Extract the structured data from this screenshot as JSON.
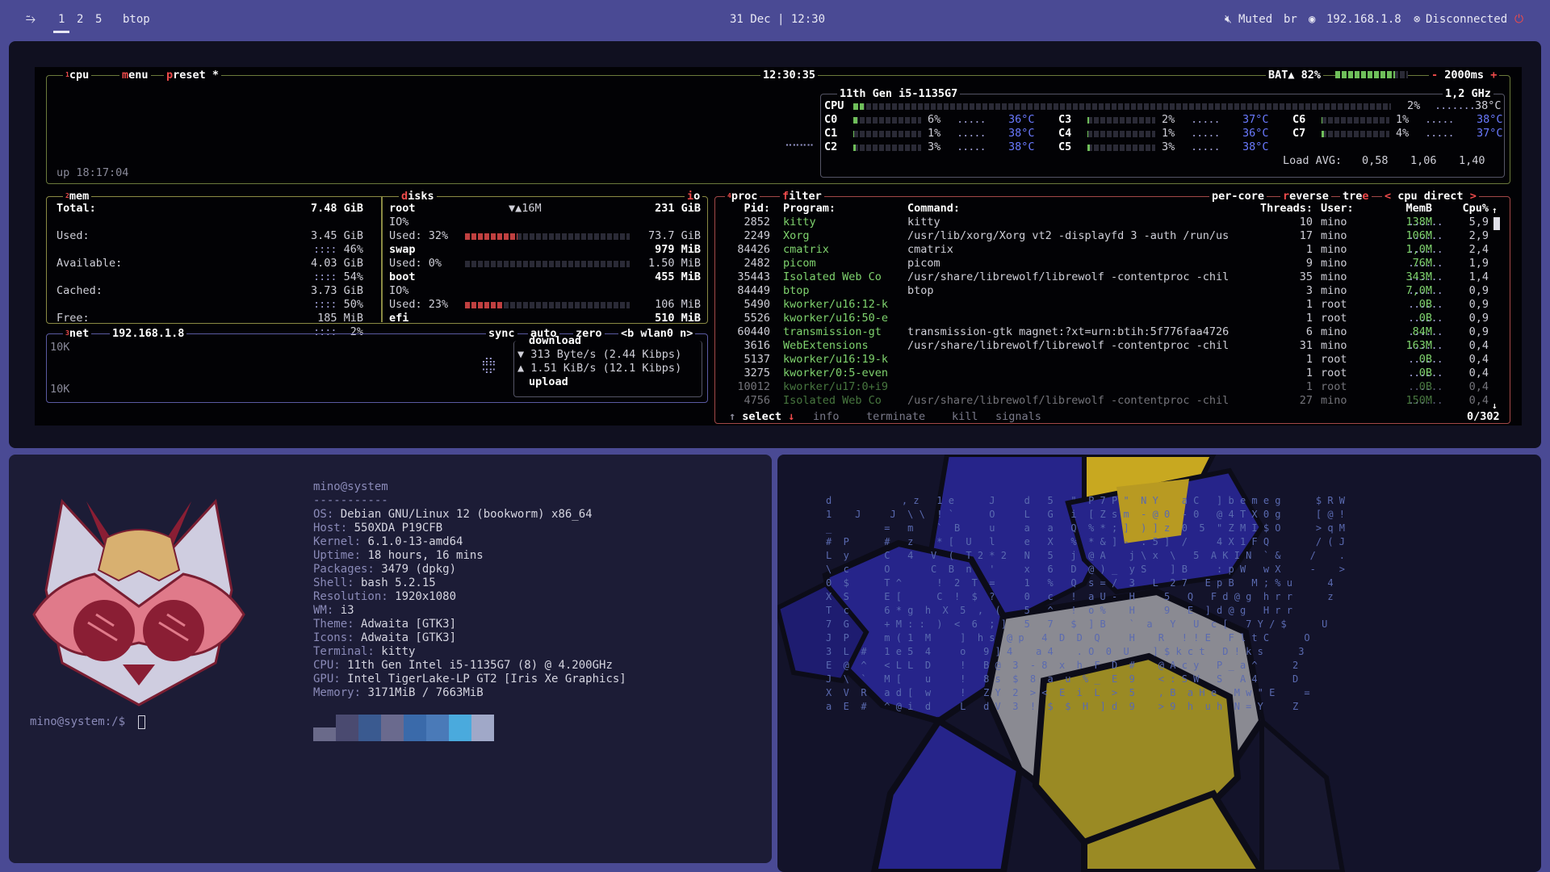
{
  "topbar": {
    "workspaces": [
      "1",
      "2",
      "5"
    ],
    "active_workspace": "1",
    "app_name": "btop",
    "datetime": "31 Dec | 12:30",
    "audio": "Muted",
    "keyboard_layout": "br",
    "ip": "192.168.1.8",
    "vpn": "Disconnected"
  },
  "btop": {
    "cpu_box": {
      "tabs": [
        "cpu",
        "menu",
        "preset *"
      ],
      "clock": "12:30:35",
      "battery": "BAT▲ 82%",
      "refresh": "2000ms",
      "model": "11th Gen i5-1135G7",
      "freq": "1,2 GHz",
      "uptime": "up 18:17:04",
      "total": {
        "label": "CPU",
        "pct": "2%",
        "temp": "38°C",
        "value": 2
      },
      "cores": [
        {
          "name": "C0",
          "pct": "6%",
          "temp": "36°C",
          "value": 6
        },
        {
          "name": "C1",
          "pct": "1%",
          "temp": "38°C",
          "value": 1
        },
        {
          "name": "C2",
          "pct": "3%",
          "temp": "38°C",
          "value": 3
        },
        {
          "name": "C3",
          "pct": "2%",
          "temp": "37°C",
          "value": 2
        },
        {
          "name": "C4",
          "pct": "1%",
          "temp": "36°C",
          "value": 1
        },
        {
          "name": "C5",
          "pct": "3%",
          "temp": "38°C",
          "value": 3
        },
        {
          "name": "C6",
          "pct": "1%",
          "temp": "38°C",
          "value": 1
        },
        {
          "name": "C7",
          "pct": "4%",
          "temp": "37°C",
          "value": 4
        }
      ],
      "load_avg_label": "Load AVG:",
      "load_avg": [
        "0,58",
        "1,06",
        "1,40"
      ]
    },
    "mem_box": {
      "title": "mem",
      "rows": [
        {
          "label": "Total:",
          "value": "7.48 GiB",
          "pct": ""
        },
        {
          "label": "Used:",
          "value": "3.45 GiB",
          "pct": "46%"
        },
        {
          "label": "Available:",
          "value": "4.03 GiB",
          "pct": "54%"
        },
        {
          "label": "Cached:",
          "value": "3.73 GiB",
          "pct": "50%"
        },
        {
          "label": "Free:",
          "value": "185 MiB",
          "pct": "2%"
        }
      ]
    },
    "disks_box": {
      "title": "disks",
      "io_label": "io",
      "disks": [
        {
          "name": "root",
          "io_rate": "▼▲16M",
          "size": "231 GiB",
          "io": "IO%",
          "used_label": "Used: 32%",
          "used": "73.7 GiB",
          "value": 32
        },
        {
          "name": "swap",
          "io_rate": "",
          "size": "979 MiB",
          "io": "",
          "used_label": "Used:  0%",
          "used": "1.50 MiB",
          "value": 0
        },
        {
          "name": "boot",
          "io_rate": "",
          "size": "455 MiB",
          "io": "IO%",
          "used_label": "Used: 23%",
          "used": "106 MiB",
          "value": 23
        },
        {
          "name": "efi",
          "io_rate": "",
          "size": "510 MiB",
          "io": "",
          "used_label": "",
          "used": "",
          "value": 0
        }
      ]
    },
    "net_box": {
      "title": "net",
      "ip": "192.168.1.8",
      "opts": [
        "sync",
        "auto",
        "zero",
        "<b wlan0 n>"
      ],
      "scale_top": "10K",
      "scale_bottom": "10K",
      "download_label": "download",
      "download": "▼ 313 Byte/s (2.44 Kibps)",
      "upload": "▲ 1.51 KiB/s (12.1 Kibps)",
      "upload_label": "upload"
    },
    "proc_box": {
      "tabs": [
        "proc",
        "filter"
      ],
      "opts": [
        "per-core",
        "reverse",
        "tree",
        "< cpu direct >"
      ],
      "columns": [
        "Pid:",
        "Program:",
        "Command:",
        "Threads:",
        "User:",
        "MemB",
        "Cpu%"
      ],
      "rows": [
        {
          "pid": "2852",
          "program": "kitty",
          "command": "kitty",
          "threads": "10",
          "user": "mino",
          "mem": "138M",
          "cpu": "5,9"
        },
        {
          "pid": "2249",
          "program": "Xorg",
          "command": "/usr/lib/xorg/Xorg vt2 -displayfd 3 -auth /run/us",
          "threads": "17",
          "user": "mino",
          "mem": "106M",
          "cpu": "2,9"
        },
        {
          "pid": "84426",
          "program": "cmatrix",
          "command": "cmatrix",
          "threads": "1",
          "user": "mino",
          "mem": "1,0M",
          "cpu": "2,4"
        },
        {
          "pid": "2482",
          "program": "picom",
          "command": "picom",
          "threads": "9",
          "user": "mino",
          "mem": "76M",
          "cpu": "1,9"
        },
        {
          "pid": "35443",
          "program": "Isolated Web Co",
          "command": "/usr/share/librewolf/librewolf -contentproc -chil",
          "threads": "35",
          "user": "mino",
          "mem": "343M",
          "cpu": "1,4"
        },
        {
          "pid": "84449",
          "program": "btop",
          "command": "btop",
          "threads": "3",
          "user": "mino",
          "mem": "7,0M",
          "cpu": "0,9"
        },
        {
          "pid": "5490",
          "program": "kworker/u16:12-k",
          "command": "",
          "threads": "1",
          "user": "root",
          "mem": "0B",
          "cpu": "0,9"
        },
        {
          "pid": "5526",
          "program": "kworker/u16:50-e",
          "command": "",
          "threads": "1",
          "user": "root",
          "mem": "0B",
          "cpu": "0,9"
        },
        {
          "pid": "60440",
          "program": "transmission-gt",
          "command": "transmission-gtk magnet:?xt=urn:btih:5f776faa4726",
          "threads": "6",
          "user": "mino",
          "mem": "84M",
          "cpu": "0,9"
        },
        {
          "pid": "3616",
          "program": "WebExtensions",
          "command": "/usr/share/librewolf/librewolf -contentproc -chil",
          "threads": "31",
          "user": "mino",
          "mem": "163M",
          "cpu": "0,4"
        },
        {
          "pid": "5137",
          "program": "kworker/u16:19-k",
          "command": "",
          "threads": "1",
          "user": "root",
          "mem": "0B",
          "cpu": "0,4"
        },
        {
          "pid": "3275",
          "program": "kworker/0:5-even",
          "command": "",
          "threads": "1",
          "user": "root",
          "mem": "0B",
          "cpu": "0,4"
        },
        {
          "pid": "10012",
          "program": "kworker/u17:0+i9",
          "command": "",
          "threads": "1",
          "user": "root",
          "mem": "0B",
          "cpu": "0,4"
        },
        {
          "pid": "4756",
          "program": "Isolated Web Co",
          "command": "/usr/share/librewolf/librewolf -contentproc -chil",
          "threads": "27",
          "user": "mino",
          "mem": "150M",
          "cpu": "0,4"
        }
      ],
      "footer": [
        "select",
        "info",
        "terminate",
        "kill",
        "signals"
      ],
      "count": "0/302"
    }
  },
  "terminal": {
    "header": "mino@system",
    "separator": "-----------",
    "info": [
      {
        "key": "OS",
        "value": "Debian GNU/Linux 12 (bookworm) x86_64"
      },
      {
        "key": "Host",
        "value": "550XDA P19CFB"
      },
      {
        "key": "Kernel",
        "value": "6.1.0-13-amd64"
      },
      {
        "key": "Uptime",
        "value": "18 hours, 16 mins"
      },
      {
        "key": "Packages",
        "value": "3479 (dpkg)"
      },
      {
        "key": "Shell",
        "value": "bash 5.2.15"
      },
      {
        "key": "Resolution",
        "value": "1920x1080"
      },
      {
        "key": "WM",
        "value": "i3"
      },
      {
        "key": "Theme",
        "value": "Adwaita [GTK3]"
      },
      {
        "key": "Icons",
        "value": "Adwaita [GTK3]"
      },
      {
        "key": "Terminal",
        "value": "kitty"
      },
      {
        "key": "CPU",
        "value": "11th Gen Intel i5-1135G7 (8) @ 4.200GHz"
      },
      {
        "key": "GPU",
        "value": "Intel TigerLake-LP GT2 [Iris Xe Graphics]"
      },
      {
        "key": "Memory",
        "value": "3171MiB / 7663MiB"
      }
    ],
    "palette": [
      "#6a6a8a",
      "#4a4a70",
      "#3a5a90",
      "#6a6a8e",
      "#3a6aaa",
      "#4a7ab8",
      "#4aaadd",
      "#a0a8c8"
    ],
    "prompt": "mino@system:/$"
  }
}
